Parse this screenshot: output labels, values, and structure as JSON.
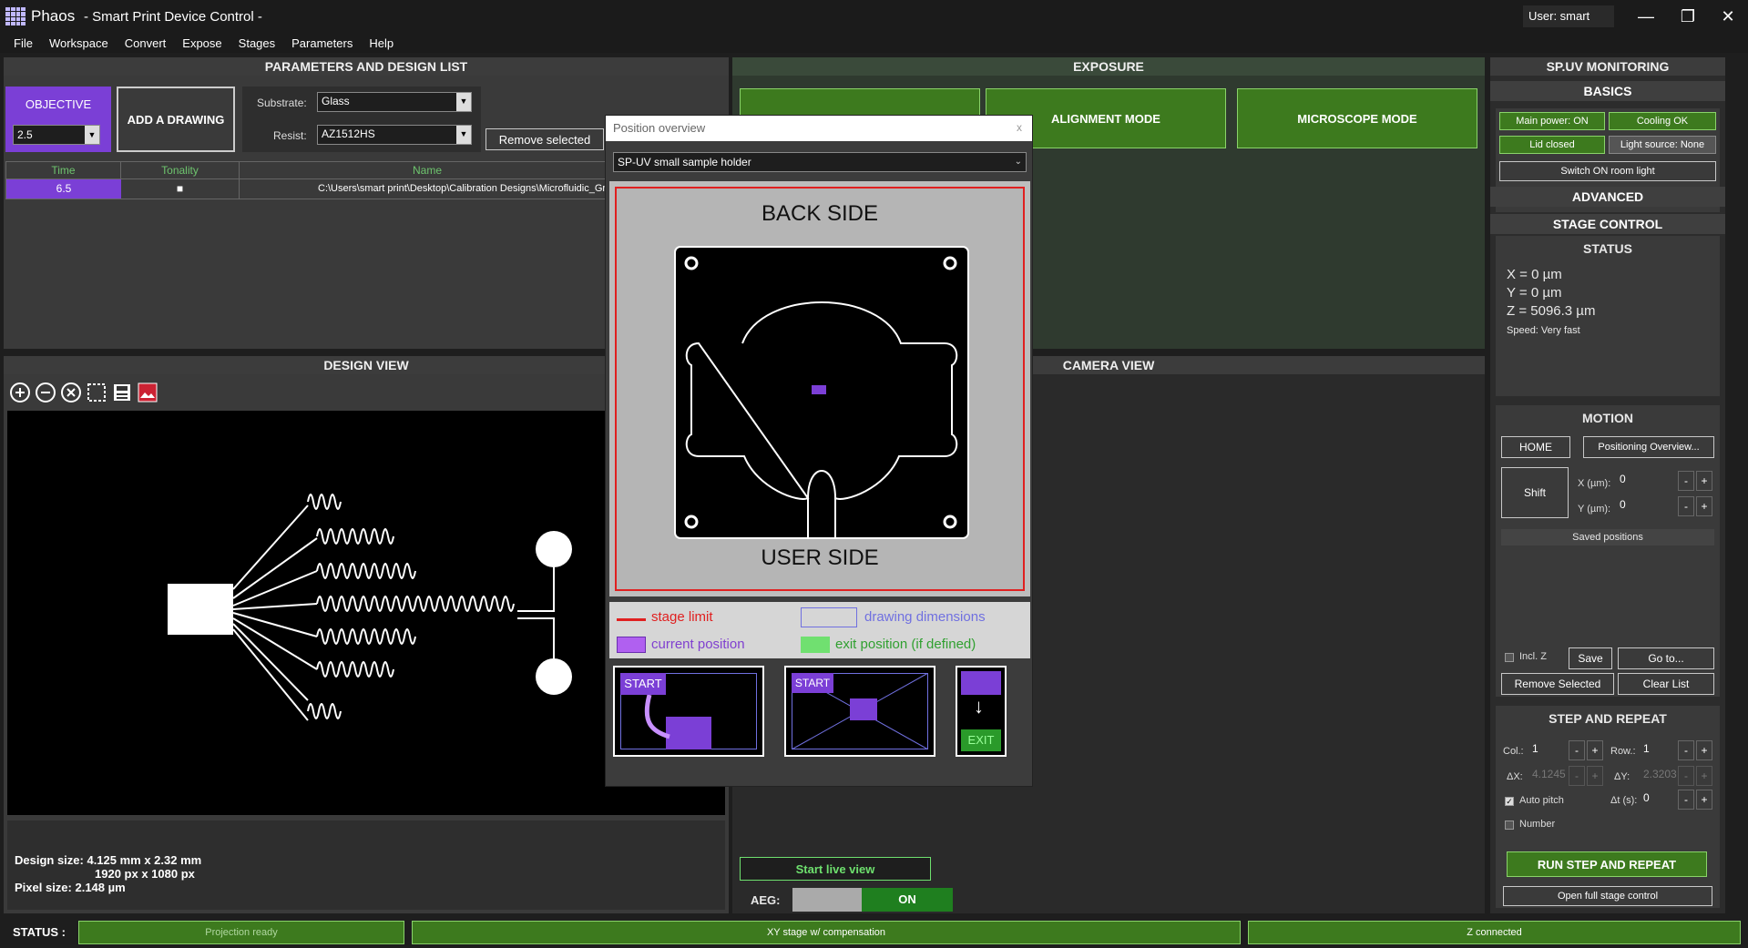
{
  "titlebar": {
    "app_name": "Phaos",
    "subtitle": "- Smart Print Device Control -",
    "user": "User: smart print",
    "min": "—",
    "restore": "❐",
    "close": "✕"
  },
  "menu": [
    "File",
    "Workspace",
    "Convert",
    "Expose",
    "Stages",
    "Parameters",
    "Help"
  ],
  "params": {
    "title": "PARAMETERS AND DESIGN LIST",
    "objective_label": "OBJECTIVE",
    "objective_value": "2.5",
    "add_drawing": "ADD A DRAWING",
    "substrate_label": "Substrate:",
    "substrate_value": "Glass",
    "resist_label": "Resist:",
    "resist_value": "AZ1512HS",
    "remove_selected": "Remove selected",
    "columns": [
      "Time",
      "Tonality",
      "Name"
    ],
    "row": {
      "time": "6.5",
      "tonality": "■",
      "name": "C:\\Users\\smart print\\Desktop\\Calibration Designs\\Microfluidic_Gra"
    }
  },
  "design": {
    "title": "DESIGN VIEW",
    "size_line": "Design size: 4.125 mm x 2.32 mm",
    "px_line": "1920 px x 1080 px",
    "pixel_line": "Pixel size: 2.148 µm",
    "tools": [
      "zoom-in-icon",
      "zoom-out-icon",
      "fit-icon",
      "select-icon",
      "save-icon",
      "image-icon"
    ]
  },
  "exposure": {
    "title": "EXPOSURE",
    "alignment": "ALIGNMENT MODE",
    "microscope": "MICROSCOPE MODE"
  },
  "camera": {
    "title": "CAMERA VIEW",
    "live": "Start live view",
    "aeg_label": "AEG:",
    "aeg_value": "ON"
  },
  "position": {
    "title": "Position overview",
    "holder": "SP-UV small sample holder",
    "back": "BACK SIDE",
    "user": "USER SIDE",
    "legend": {
      "limit": "stage limit",
      "dims": "drawing dimensions",
      "current": "current position",
      "exit": "exit position (if defined)"
    },
    "start": "START",
    "exit": "EXIT",
    "close": "x",
    "colors": {
      "limit": "#e02020",
      "dims": "#7070e0",
      "current": "#b060f0",
      "exit": "#40c040"
    }
  },
  "monitor": {
    "title": "SP.UV MONITORING",
    "basics": "BASICS",
    "main_power": "Main power: ON",
    "cooling": "Cooling OK",
    "lid": "Lid closed",
    "light": "Light source: None",
    "room_light": "Switch ON room light",
    "advanced": "ADVANCED",
    "stage_control": "STAGE CONTROL",
    "status": "STATUS",
    "x": "X = 0 µm",
    "y": "Y = 0 µm",
    "z": "Z = 5096.3 µm",
    "speed": "Speed: Very fast",
    "motion": "MOTION",
    "home": "HOME",
    "positioning": "Positioning Overview...",
    "shift": "Shift",
    "x_label": "X (µm):",
    "x_val": "0",
    "y_label": "Y (µm):",
    "y_val": "0",
    "saved": "Saved positions",
    "incl_z": "Incl. Z",
    "save": "Save",
    "goto": "Go to...",
    "remove_sel": "Remove Selected",
    "clear": "Clear List",
    "step": "STEP AND REPEAT",
    "col_label": "Col.:",
    "col_val": "1",
    "row_label": "Row.:",
    "row_val": "1",
    "dx_label": "ΔX:",
    "dx_val": "4.1245",
    "dy_label": "ΔY:",
    "dy_val": "2.3203",
    "auto_pitch": "Auto pitch",
    "dt_label": "Δt (s):",
    "dt_val": "0",
    "number": "Number",
    "run": "RUN STEP AND REPEAT",
    "full_stage": "Open full stage control",
    "minus": "-",
    "plus": "+"
  },
  "status": {
    "label": "STATUS :",
    "projection": "Projection ready",
    "xy": "XY stage w/ compensation",
    "z": "Z connected"
  }
}
